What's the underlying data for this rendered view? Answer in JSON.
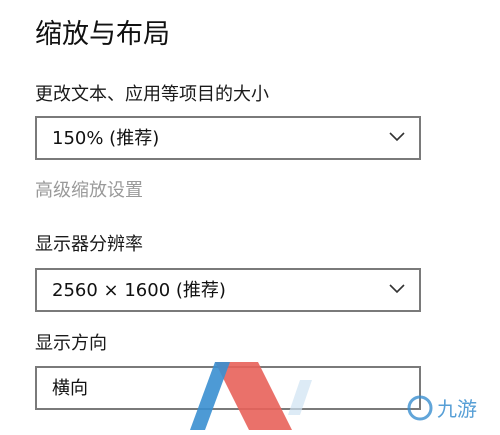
{
  "title": "缩放与布局",
  "scale": {
    "label": "更改文本、应用等项目的大小",
    "selected": "150% (推荐)"
  },
  "advanced_scaling_link": "高级缩放设置",
  "resolution": {
    "label": "显示器分辨率",
    "selected": "2560 × 1600 (推荐)"
  },
  "orientation": {
    "label": "显示方向",
    "selected": "横向"
  },
  "watermark": {
    "text": "九游",
    "colors": {
      "red": "#e8625a",
      "blue": "#3a8fd0"
    }
  },
  "colors": {
    "text": "#111111",
    "disabled_text": "#9a9a9a",
    "border": "#7a7a7a"
  }
}
